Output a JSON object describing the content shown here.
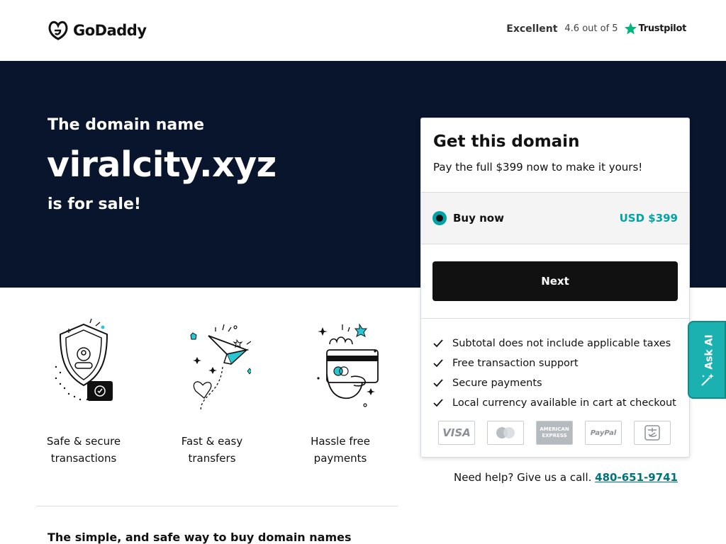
{
  "header": {
    "brand": "GoDaddy",
    "trust_rating": "Excellent",
    "trust_score": "4.6 out of 5",
    "trust_brand": "Trustpilot"
  },
  "hero": {
    "intro": "The domain name",
    "domain": "viralcity.xyz",
    "sale": "is for sale!"
  },
  "card": {
    "title": "Get this domain",
    "subtitle": "Pay the full $399 now to make it yours!",
    "option_label": "Buy now",
    "option_price": "USD $399",
    "next_label": "Next",
    "features": [
      "Subtotal does not include applicable taxes",
      "Free transaction support",
      "Secure payments",
      "Local currency available in cart at checkout"
    ],
    "payments": [
      "VISA",
      "mastercard",
      "AMERICAN EXPRESS",
      "PayPal",
      "alipay"
    ]
  },
  "help": {
    "text": "Need help? Give us a call.",
    "phone": "480-651-9741"
  },
  "ai_tab": {
    "label": "Ask AI"
  },
  "benefits": [
    {
      "line1": "Safe & secure",
      "line2": "transactions"
    },
    {
      "line1": "Fast & easy",
      "line2": "transfers"
    },
    {
      "line1": "Hassle free",
      "line2": "payments"
    }
  ],
  "bottom": {
    "heading": "The simple, and safe way to buy domain names"
  },
  "colors": {
    "hero_bg": "#09152d",
    "accent": "#00a4a6",
    "button": "#111111"
  }
}
